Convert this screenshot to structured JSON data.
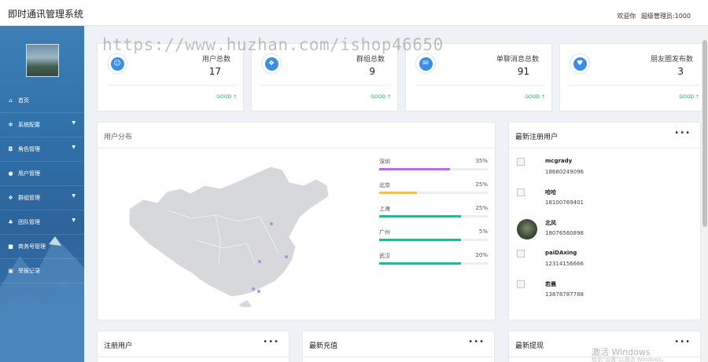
{
  "header": {
    "app_title": "即时通讯管理系统",
    "welcome": "欢迎你",
    "user": "超级管理员:1000"
  },
  "sidebar": {
    "items": [
      {
        "label": "首页",
        "icon": "home-icon",
        "glyph": "⌂",
        "caret": false
      },
      {
        "label": "系统配置",
        "icon": "gear-icon",
        "glyph": "✻",
        "caret": true
      },
      {
        "label": "角色管理",
        "icon": "lock-icon",
        "glyph": "◘",
        "caret": true
      },
      {
        "label": "用户管理",
        "icon": "user-icon",
        "glyph": "●",
        "caret": false
      },
      {
        "label": "群组管理",
        "icon": "group-icon",
        "glyph": "❖",
        "caret": true
      },
      {
        "label": "团队管理",
        "icon": "team-icon",
        "glyph": "♣",
        "caret": true
      },
      {
        "label": "商务号管理",
        "icon": "book-icon",
        "glyph": "■",
        "caret": false
      },
      {
        "label": "举报记录",
        "icon": "report-icon",
        "glyph": "▣",
        "caret": false
      }
    ]
  },
  "stats": [
    {
      "label": "用户总数",
      "value": "17",
      "footer": "GOOD ↑",
      "icon": "user-icon",
      "glyph": "☺"
    },
    {
      "label": "群组总数",
      "value": "9",
      "footer": "GOOD ↑",
      "icon": "group-icon",
      "glyph": "❖"
    },
    {
      "label": "单聊消息总数",
      "value": "91",
      "footer": "GOOD ↑",
      "icon": "mail-icon",
      "glyph": "✉"
    },
    {
      "label": "朋友圈发布数",
      "value": "3",
      "footer": "GOOD ↑",
      "icon": "heart-icon",
      "glyph": "♥"
    }
  ],
  "distribution": {
    "title": "用户分布",
    "cities": [
      {
        "name": "深圳",
        "percent": "35%",
        "value": 0.65,
        "color": "#b76ee0"
      },
      {
        "name": "北京",
        "percent": "25%",
        "value": 0.35,
        "color": "#f0c05a"
      },
      {
        "name": "上海",
        "percent": "25%",
        "value": 0.75,
        "color": "#2fb596"
      },
      {
        "name": "广州",
        "percent": "5%",
        "value": 0.75,
        "color": "#2fb596"
      },
      {
        "name": "武汉",
        "percent": "20%",
        "value": 0.75,
        "color": "#2fb596"
      }
    ]
  },
  "new_users": {
    "title": "最新注册用户",
    "menu": "•••",
    "items": [
      {
        "name": "mcgrady",
        "phone": "18680249096",
        "avatar": "broken"
      },
      {
        "name": "哈哈",
        "phone": "18100769401",
        "avatar": "broken"
      },
      {
        "name": "北风",
        "phone": "18076560898",
        "avatar": "photo"
      },
      {
        "name": "paiDAxing",
        "phone": "12314156666",
        "avatar": "broken"
      },
      {
        "name": "若晨",
        "phone": "13878787788",
        "avatar": "broken"
      }
    ]
  },
  "bottom_panels": [
    {
      "title": "注册用户",
      "menu": "•••"
    },
    {
      "title": "最新充值",
      "menu": "•••"
    },
    {
      "title": "最新提现",
      "menu": "•••"
    }
  ],
  "watermark": "https://www.huzhan.com/ishop46650",
  "windows_watermark": {
    "line1": "激活 Windows",
    "line2": "转到\"设置\"以激活 Windows。"
  }
}
